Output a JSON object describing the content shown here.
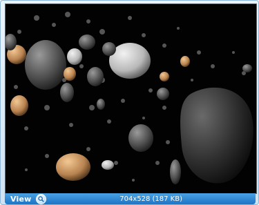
{
  "viewer": {
    "image_alt": "Asteroid belt rendering",
    "status": {
      "view_label": "View",
      "zoom_icon": "magnifier-icon",
      "image_info": "704x528 (187 KB)"
    }
  },
  "colors": {
    "frame_border": "#8fb6d6",
    "statusbar_top": "#4aa2e4",
    "statusbar_bottom": "#1c74c6",
    "background": "#000000"
  }
}
